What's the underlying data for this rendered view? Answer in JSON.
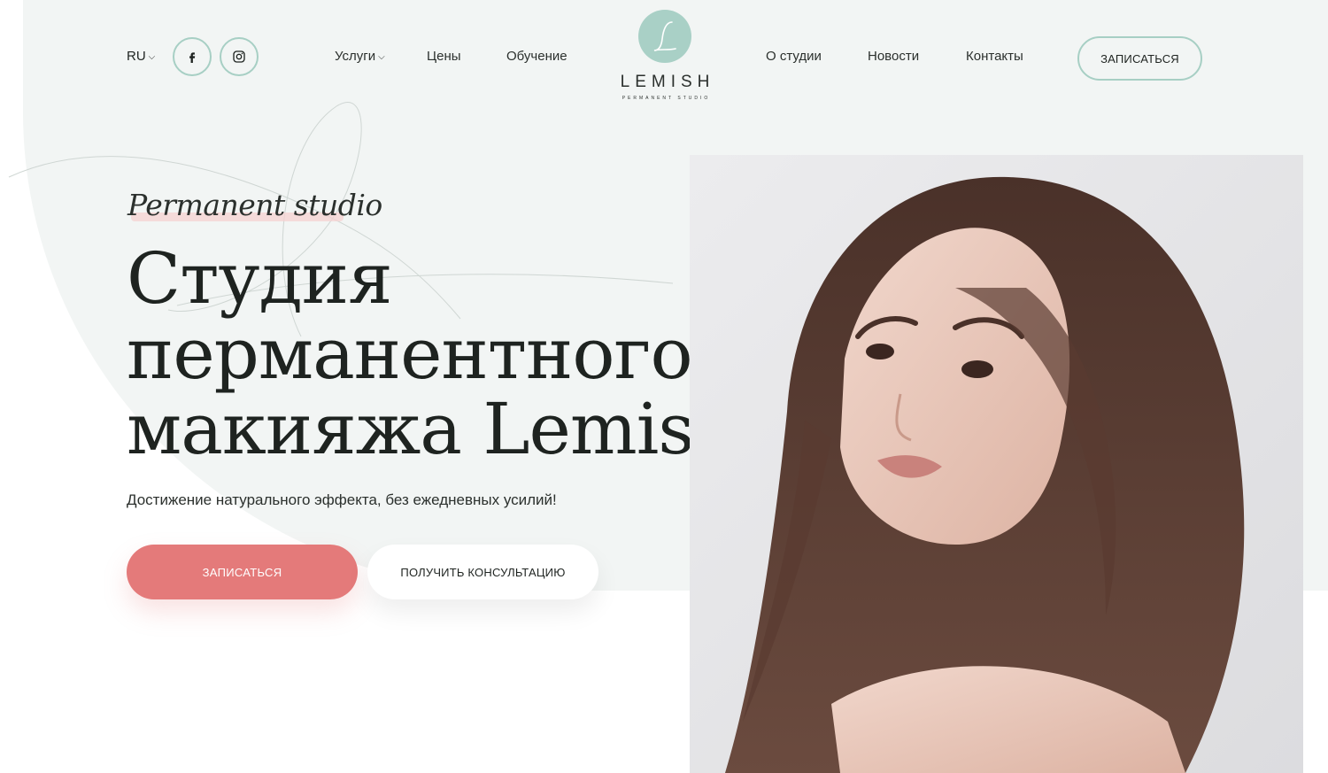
{
  "header": {
    "language": "RU",
    "social": {
      "facebook_icon": "facebook-icon",
      "instagram_icon": "instagram-icon"
    },
    "nav_left": [
      {
        "label": "Услуги",
        "has_dropdown": true
      },
      {
        "label": "Цены"
      },
      {
        "label": "Обучение"
      }
    ],
    "logo": {
      "name": "LEMISH",
      "tagline": "PERMANENT STUDIO",
      "mark": "L"
    },
    "nav_right": [
      {
        "label": "О студии"
      },
      {
        "label": "Новости"
      },
      {
        "label": "Контакты"
      }
    ],
    "cta_label": "ЗАПИСАТЬСЯ"
  },
  "hero": {
    "script_title": "Permanent studio",
    "title_lines": [
      "Студия",
      "перманентного",
      "макияжа Lemish"
    ],
    "subtitle": "Достижение натурального эффекта, без ежедневных усилий!",
    "primary_button": "ЗАПИСАТЬСЯ",
    "secondary_button": "ПОЛУЧИТЬ КОНСУЛЬТАЦИЮ"
  },
  "colors": {
    "accent_mint": "#a7cfc4",
    "accent_coral": "#e47a7a",
    "panel_bg": "#f2f5f4",
    "text_dark": "#1e2320"
  }
}
